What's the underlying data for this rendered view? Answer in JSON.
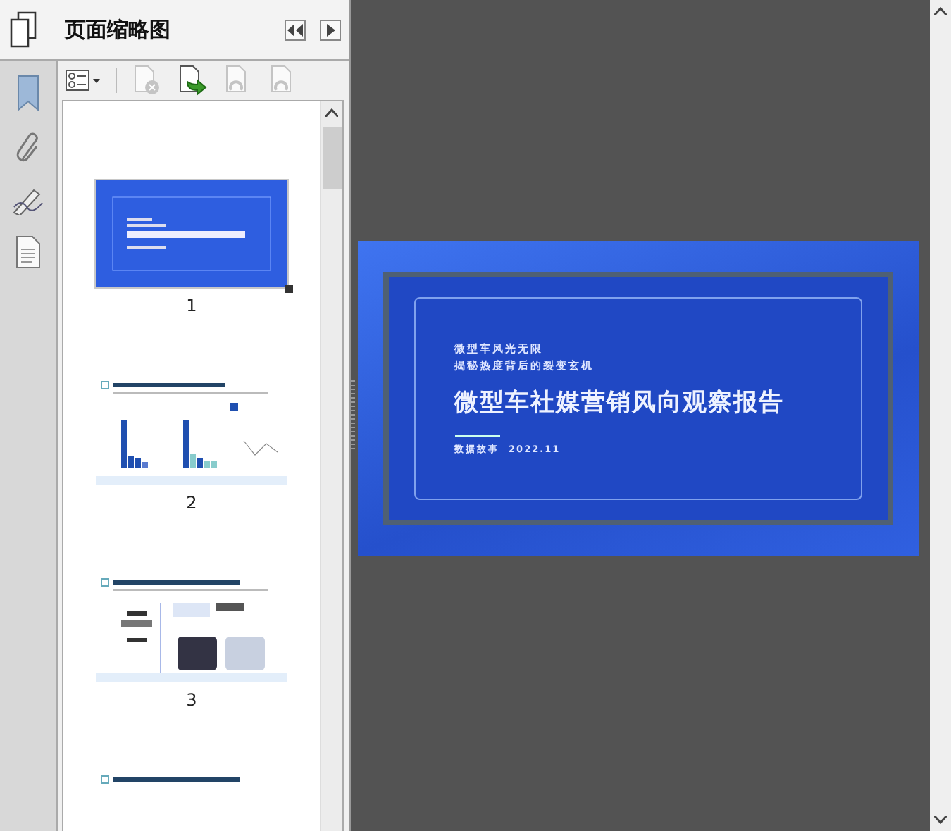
{
  "panel": {
    "title": "页面缩略图"
  },
  "toolbar": [
    {
      "kind": "options",
      "disabled": false
    },
    {
      "kind": "delete",
      "disabled": true
    },
    {
      "kind": "insert",
      "disabled": false
    },
    {
      "kind": "rotate",
      "disabled": true
    },
    {
      "kind": "rotate",
      "disabled": true
    }
  ],
  "pages": [
    {
      "kind": "title",
      "label": "1",
      "selected": true
    },
    {
      "kind": "chart",
      "label": "2",
      "selected": false
    },
    {
      "kind": "photo",
      "label": "3",
      "selected": false
    },
    {
      "kind": "text",
      "selected": false
    }
  ],
  "slide": {
    "subtitle_lines": [
      "微型车风光无限",
      "揭秘热度背后的裂变玄机"
    ],
    "title": "微型车社媒营销风向观察报告",
    "footer": "数据故事  2022.11"
  }
}
